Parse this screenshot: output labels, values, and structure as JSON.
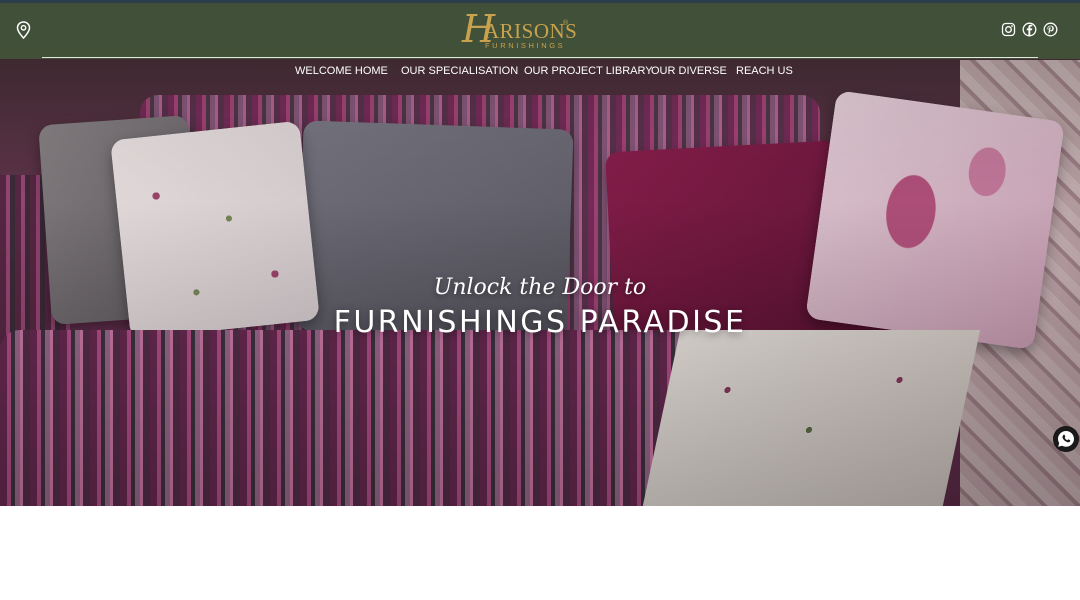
{
  "brand": {
    "logo_initial": "H",
    "logo_word": "ARISONS",
    "logo_registered": "®",
    "logo_subtitle": "FURNISHINGS",
    "accent_color": "#c9a24e",
    "header_color": "#42543a"
  },
  "header": {
    "location_icon": "map-pin-icon",
    "social_icons": [
      "instagram-icon",
      "facebook-icon",
      "pinterest-icon"
    ]
  },
  "nav": {
    "items": [
      {
        "label": "WELCOME HOME"
      },
      {
        "label": "OUR SPECIALISATION"
      },
      {
        "label": "OUR PROJECT LIBRARY"
      },
      {
        "label": "OUR DIVERSE"
      },
      {
        "label": "REACH US"
      }
    ]
  },
  "hero": {
    "tagline": "Unlock the Door to",
    "headline": "FURNISHINGS PARADISE"
  },
  "floating": {
    "whatsapp_icon": "whatsapp-icon",
    "whatsapp_color": "#25d366"
  }
}
